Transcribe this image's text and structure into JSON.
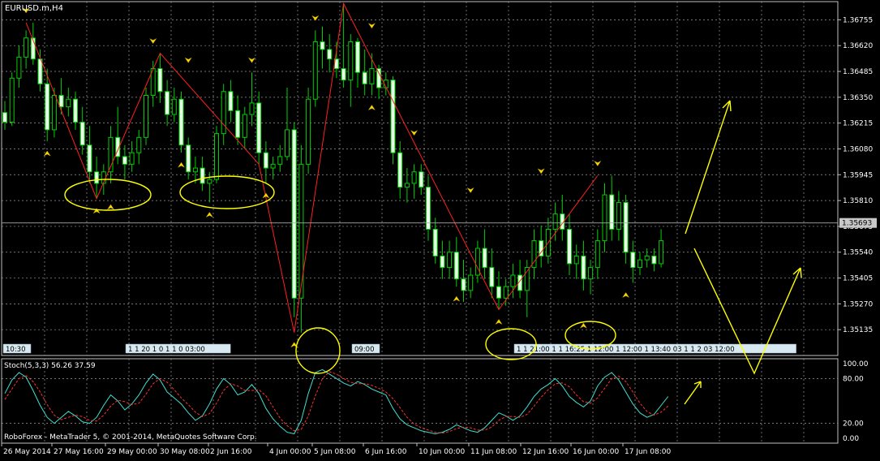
{
  "window": {
    "title": "EURUSD.m,H4",
    "footer": "RoboForex - MetaTrader 5, © 2001-2014, MetaQuotes Software Corp."
  },
  "chart_data": {
    "type": "candlestick",
    "symbol": "EURUSD.m",
    "timeframe": "H4",
    "price_axis": {
      "range": [
        1.35,
        1.3685
      ],
      "ticks": [
        "1.36755",
        "1.36620",
        "1.36485",
        "1.36350",
        "1.36215",
        "1.36080",
        "1.35945",
        "1.35810",
        "1.35675",
        "1.35540",
        "1.35405",
        "1.35270",
        "1.35135"
      ],
      "current_price": "1.35693"
    },
    "time_axis": {
      "labels": [
        "26 May 2014",
        "27 May 16:00",
        "29 May 00:00",
        "30 May 08:00",
        "2 Jun 16:00",
        "4 Jun 00:00",
        "5 Jun 08:00",
        "6 Jun 16:00",
        "10 Jun 00:00",
        "11 Jun 08:00",
        "12 Jun 16:00",
        "16 Jun 00:00",
        "17 Jun 08:00"
      ]
    },
    "grid": true,
    "candles": [
      [
        1.3627,
        1.3633,
        1.3618,
        1.3622
      ],
      [
        1.3622,
        1.3648,
        1.362,
        1.3645
      ],
      [
        1.3645,
        1.3662,
        1.364,
        1.3656
      ],
      [
        1.3656,
        1.367,
        1.365,
        1.3666
      ],
      [
        1.3666,
        1.3674,
        1.3652,
        1.3655
      ],
      [
        1.3655,
        1.366,
        1.3638,
        1.3642
      ],
      [
        1.3642,
        1.365,
        1.3612,
        1.3618
      ],
      [
        1.3618,
        1.364,
        1.3614,
        1.3636
      ],
      [
        1.3636,
        1.3645,
        1.3626,
        1.363
      ],
      [
        1.363,
        1.364,
        1.3625,
        1.3634
      ],
      [
        1.3634,
        1.3638,
        1.3618,
        1.3622
      ],
      [
        1.3622,
        1.363,
        1.3605,
        1.361
      ],
      [
        1.361,
        1.362,
        1.359,
        1.3596
      ],
      [
        1.3596,
        1.3604,
        1.3582,
        1.359
      ],
      [
        1.359,
        1.36,
        1.3584,
        1.3596
      ],
      [
        1.3596,
        1.362,
        1.359,
        1.3614
      ],
      [
        1.3614,
        1.363,
        1.36,
        1.3604
      ],
      [
        1.3604,
        1.361,
        1.3592,
        1.36
      ],
      [
        1.36,
        1.3612,
        1.3596,
        1.3606
      ],
      [
        1.3606,
        1.3618,
        1.36,
        1.3614
      ],
      [
        1.3614,
        1.364,
        1.361,
        1.3636
      ],
      [
        1.3636,
        1.3654,
        1.363,
        1.365
      ],
      [
        1.365,
        1.3658,
        1.3632,
        1.3638
      ],
      [
        1.3638,
        1.3644,
        1.362,
        1.3626
      ],
      [
        1.3626,
        1.364,
        1.3622,
        1.3634
      ],
      [
        1.3634,
        1.3638,
        1.3606,
        1.361
      ],
      [
        1.361,
        1.3614,
        1.3592,
        1.3596
      ],
      [
        1.3596,
        1.3604,
        1.359,
        1.3598
      ],
      [
        1.3598,
        1.3604,
        1.3586,
        1.359
      ],
      [
        1.359,
        1.3596,
        1.358,
        1.3592
      ],
      [
        1.3592,
        1.362,
        1.359,
        1.3616
      ],
      [
        1.3616,
        1.3642,
        1.361,
        1.3638
      ],
      [
        1.3638,
        1.3644,
        1.3622,
        1.3628
      ],
      [
        1.3628,
        1.3636,
        1.361,
        1.3614
      ],
      [
        1.3614,
        1.363,
        1.3608,
        1.3626
      ],
      [
        1.3626,
        1.3648,
        1.362,
        1.3632
      ],
      [
        1.3632,
        1.3638,
        1.36,
        1.3606
      ],
      [
        1.3606,
        1.3612,
        1.359,
        1.3598
      ],
      [
        1.3598,
        1.3604,
        1.3592,
        1.36
      ],
      [
        1.36,
        1.361,
        1.3596,
        1.3604
      ],
      [
        1.3604,
        1.364,
        1.3602,
        1.3618
      ],
      [
        1.3618,
        1.3622,
        1.352,
        1.353
      ],
      [
        1.353,
        1.361,
        1.3512,
        1.36
      ],
      [
        1.36,
        1.364,
        1.3595,
        1.3634
      ],
      [
        1.3634,
        1.367,
        1.363,
        1.3664
      ],
      [
        1.3664,
        1.3672,
        1.365,
        1.366
      ],
      [
        1.366,
        1.3668,
        1.3648,
        1.3655
      ],
      [
        1.3655,
        1.3664,
        1.3645,
        1.365
      ],
      [
        1.365,
        1.3684,
        1.364,
        1.3644
      ],
      [
        1.3644,
        1.3668,
        1.363,
        1.3664
      ],
      [
        1.3664,
        1.3666,
        1.364,
        1.3648
      ],
      [
        1.3648,
        1.366,
        1.3636,
        1.3642
      ],
      [
        1.3642,
        1.3658,
        1.3636,
        1.365
      ],
      [
        1.365,
        1.3652,
        1.3634,
        1.364
      ],
      [
        1.364,
        1.3648,
        1.3636,
        1.3644
      ],
      [
        1.3644,
        1.3646,
        1.36,
        1.3606
      ],
      [
        1.3606,
        1.3612,
        1.3582,
        1.3588
      ],
      [
        1.3588,
        1.3598,
        1.358,
        1.359
      ],
      [
        1.359,
        1.36,
        1.3582,
        1.3596
      ],
      [
        1.3596,
        1.36,
        1.3584,
        1.3588
      ],
      [
        1.3588,
        1.3594,
        1.356,
        1.3566
      ],
      [
        1.3566,
        1.3572,
        1.3548,
        1.3552
      ],
      [
        1.3552,
        1.356,
        1.354,
        1.3546
      ],
      [
        1.3546,
        1.356,
        1.354,
        1.3554
      ],
      [
        1.3554,
        1.3562,
        1.3536,
        1.354
      ],
      [
        1.354,
        1.355,
        1.3528,
        1.3534
      ],
      [
        1.3534,
        1.3546,
        1.353,
        1.3542
      ],
      [
        1.3542,
        1.356,
        1.3538,
        1.3556
      ],
      [
        1.3556,
        1.3566,
        1.354,
        1.3546
      ],
      [
        1.3546,
        1.3556,
        1.353,
        1.3536
      ],
      [
        1.3536,
        1.3544,
        1.3524,
        1.353
      ],
      [
        1.353,
        1.354,
        1.3526,
        1.3536
      ],
      [
        1.3536,
        1.3548,
        1.353,
        1.3542
      ],
      [
        1.3542,
        1.355,
        1.353,
        1.3534
      ],
      [
        1.3534,
        1.355,
        1.352,
        1.3546
      ],
      [
        1.3546,
        1.3566,
        1.354,
        1.356
      ],
      [
        1.356,
        1.3568,
        1.3546,
        1.3552
      ],
      [
        1.3552,
        1.3572,
        1.3548,
        1.3566
      ],
      [
        1.3566,
        1.358,
        1.356,
        1.3574
      ],
      [
        1.3574,
        1.3584,
        1.356,
        1.3566
      ],
      [
        1.3566,
        1.3574,
        1.3542,
        1.3548
      ],
      [
        1.3548,
        1.3558,
        1.354,
        1.3552
      ],
      [
        1.3552,
        1.356,
        1.3534,
        1.354
      ],
      [
        1.354,
        1.355,
        1.3532,
        1.3546
      ],
      [
        1.3546,
        1.3566,
        1.354,
        1.356
      ],
      [
        1.356,
        1.359,
        1.3554,
        1.3584
      ],
      [
        1.3584,
        1.3594,
        1.356,
        1.3566
      ],
      [
        1.3566,
        1.3586,
        1.356,
        1.358
      ],
      [
        1.358,
        1.3584,
        1.3548,
        1.3554
      ],
      [
        1.3554,
        1.356,
        1.3538,
        1.3546
      ],
      [
        1.3546,
        1.3554,
        1.3542,
        1.355
      ],
      [
        1.355,
        1.3556,
        1.3546,
        1.3552
      ],
      [
        1.3552,
        1.3556,
        1.3544,
        1.3548
      ],
      [
        1.3548,
        1.3566,
        1.3546,
        1.356
      ]
    ],
    "zigzag": [
      [
        3,
        1.3674
      ],
      [
        13,
        1.3582
      ],
      [
        22,
        1.3658
      ],
      [
        36,
        1.36
      ],
      [
        41,
        1.3512
      ],
      [
        48,
        1.3684
      ],
      [
        70,
        1.3524
      ],
      [
        84,
        1.3594
      ]
    ],
    "fractals": {
      "up": [
        [
          3,
          1.3674
        ],
        [
          21,
          1.3658
        ],
        [
          26,
          1.3648
        ],
        [
          35,
          1.3648
        ],
        [
          44,
          1.367
        ],
        [
          48,
          1.3684
        ],
        [
          52,
          1.3666
        ],
        [
          58,
          1.361
        ],
        [
          66,
          1.358
        ],
        [
          76,
          1.359
        ],
        [
          84,
          1.3594
        ]
      ],
      "down": [
        [
          6,
          1.3612
        ],
        [
          13,
          1.3582
        ],
        [
          15,
          1.3584
        ],
        [
          25,
          1.3606
        ],
        [
          29,
          1.358
        ],
        [
          37,
          1.359
        ],
        [
          41,
          1.3512
        ],
        [
          52,
          1.3636
        ],
        [
          64,
          1.3536
        ],
        [
          70,
          1.3524
        ],
        [
          82,
          1.3522
        ],
        [
          88,
          1.3538
        ]
      ]
    },
    "time_markers": [
      "10:30",
      "1 1 20 1 0 1 1 0 03:00",
      "09:00",
      "1 1 21:00 1 1 16:25 1 12:00 1 12:00 1 13:40 03 1 1 2 03 12:00"
    ],
    "stochastic": {
      "title": "Stoch(5,3,3) 56.26 37.59",
      "ticks": [
        "100.00",
        "80.00",
        "20.00",
        "0.00"
      ],
      "main": [
        60,
        78,
        88,
        82,
        64,
        44,
        28,
        20,
        28,
        36,
        30,
        22,
        20,
        28,
        44,
        58,
        50,
        38,
        46,
        58,
        74,
        86,
        78,
        62,
        54,
        46,
        34,
        24,
        30,
        46,
        66,
        80,
        72,
        58,
        62,
        72,
        60,
        40,
        26,
        16,
        8,
        6,
        24,
        60,
        88,
        92,
        86,
        80,
        74,
        70,
        76,
        72,
        66,
        62,
        58,
        40,
        26,
        18,
        14,
        10,
        8,
        6,
        8,
        12,
        18,
        14,
        10,
        8,
        14,
        24,
        34,
        30,
        24,
        30,
        42,
        56,
        66,
        72,
        80,
        70,
        56,
        48,
        42,
        50,
        70,
        82,
        88,
        78,
        62,
        46,
        34,
        28,
        32,
        44,
        56
      ],
      "signal": [
        52,
        66,
        80,
        84,
        76,
        62,
        45,
        31,
        25,
        28,
        31,
        29,
        24,
        23,
        31,
        43,
        51,
        49,
        45,
        47,
        59,
        73,
        80,
        75,
        65,
        54,
        45,
        35,
        29,
        33,
        47,
        64,
        73,
        70,
        64,
        64,
        65,
        57,
        42,
        27,
        17,
        10,
        12,
        30,
        57,
        80,
        89,
        86,
        80,
        75,
        73,
        73,
        71,
        67,
        62,
        53,
        41,
        28,
        19,
        14,
        11,
        8,
        7,
        9,
        13,
        15,
        14,
        11,
        11,
        15,
        24,
        29,
        29,
        28,
        32,
        43,
        55,
        65,
        73,
        74,
        69,
        58,
        49,
        47,
        54,
        67,
        80,
        83,
        76,
        62,
        47,
        36,
        31,
        35,
        43
      ]
    },
    "annotations": "yellow hand-drawn ellipses around swing lows; yellow arrows projecting up, down then up; small yellow up arrow on the oscillator"
  }
}
